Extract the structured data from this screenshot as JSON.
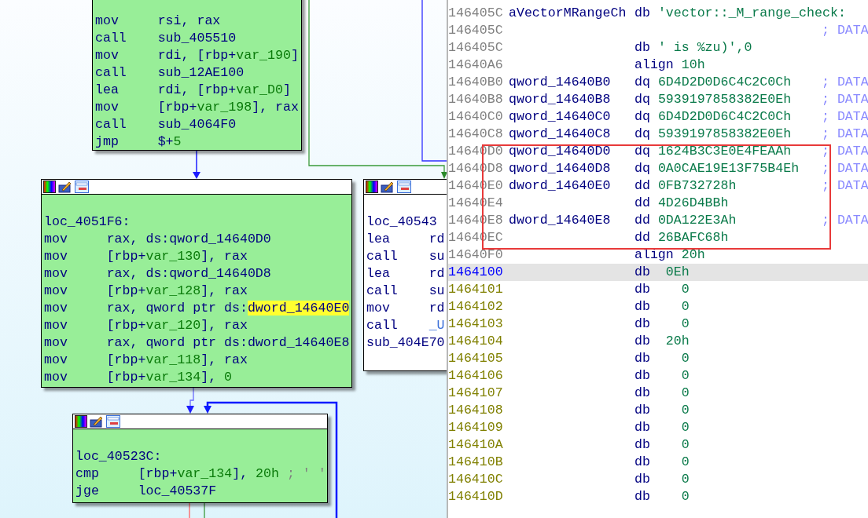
{
  "graph": {
    "nodes": [
      {
        "color": "#98ee98",
        "header": false,
        "lines": [
          {
            "kind": "insn",
            "op": "mov",
            "args": [
              {
                "kind": "plain",
                "text": "rsi, rax"
              }
            ]
          },
          {
            "kind": "insn",
            "op": "call",
            "args": [
              {
                "kind": "plain",
                "text": "sub_405510"
              }
            ]
          },
          {
            "kind": "insn",
            "op": "mov",
            "args": [
              {
                "kind": "plain",
                "text": "rdi, [rbp+"
              },
              {
                "kind": "var",
                "text": "var_190"
              },
              {
                "kind": "plain",
                "text": "]"
              }
            ]
          },
          {
            "kind": "insn",
            "op": "call",
            "args": [
              {
                "kind": "plain",
                "text": "sub_12AE100"
              }
            ]
          },
          {
            "kind": "insn",
            "op": "lea",
            "args": [
              {
                "kind": "plain",
                "text": "rdi, [rbp+"
              },
              {
                "kind": "var",
                "text": "var_D0"
              },
              {
                "kind": "plain",
                "text": "]"
              }
            ]
          },
          {
            "kind": "insn",
            "op": "mov",
            "args": [
              {
                "kind": "plain",
                "text": "[rbp+"
              },
              {
                "kind": "var",
                "text": "var_198"
              },
              {
                "kind": "plain",
                "text": "], rax"
              }
            ]
          },
          {
            "kind": "insn",
            "op": "call",
            "args": [
              {
                "kind": "plain",
                "text": "sub_4064F0"
              }
            ]
          },
          {
            "kind": "insn",
            "op": "jmp",
            "args": [
              {
                "kind": "plain",
                "text": "$+"
              },
              {
                "kind": "num",
                "text": "5"
              }
            ]
          }
        ]
      },
      {
        "color": "#98ee98",
        "header": true,
        "lines": [
          {
            "kind": "label",
            "text": "loc_4051F6:"
          },
          {
            "kind": "insn",
            "op": "mov",
            "args": [
              {
                "kind": "plain",
                "text": "rax, ds:qword_14640D0"
              }
            ]
          },
          {
            "kind": "insn",
            "op": "mov",
            "args": [
              {
                "kind": "plain",
                "text": "[rbp+"
              },
              {
                "kind": "var",
                "text": "var_130"
              },
              {
                "kind": "plain",
                "text": "], rax"
              }
            ]
          },
          {
            "kind": "insn",
            "op": "mov",
            "args": [
              {
                "kind": "plain",
                "text": "rax, ds:qword_14640D8"
              }
            ]
          },
          {
            "kind": "insn",
            "op": "mov",
            "args": [
              {
                "kind": "plain",
                "text": "[rbp+"
              },
              {
                "kind": "var",
                "text": "var_128"
              },
              {
                "kind": "plain",
                "text": "], rax"
              }
            ]
          },
          {
            "kind": "insn",
            "op": "mov",
            "args": [
              {
                "kind": "plain",
                "text": "rax, qword ptr ds:"
              },
              {
                "kind": "hl",
                "text": "dword_14640E0"
              }
            ]
          },
          {
            "kind": "insn",
            "op": "mov",
            "args": [
              {
                "kind": "plain",
                "text": "[rbp+"
              },
              {
                "kind": "var",
                "text": "var_120"
              },
              {
                "kind": "plain",
                "text": "], rax"
              }
            ]
          },
          {
            "kind": "insn",
            "op": "mov",
            "args": [
              {
                "kind": "plain",
                "text": "rax, qword ptr ds:dword_14640E8"
              }
            ]
          },
          {
            "kind": "insn",
            "op": "mov",
            "args": [
              {
                "kind": "plain",
                "text": "[rbp+"
              },
              {
                "kind": "var",
                "text": "var_118"
              },
              {
                "kind": "plain",
                "text": "], rax"
              }
            ]
          },
          {
            "kind": "insn",
            "op": "mov",
            "args": [
              {
                "kind": "plain",
                "text": "[rbp+"
              },
              {
                "kind": "var",
                "text": "var_134"
              },
              {
                "kind": "plain",
                "text": "], "
              },
              {
                "kind": "num",
                "text": "0"
              }
            ]
          }
        ]
      },
      {
        "color": "#ffffff",
        "header": true,
        "lines": [
          {
            "kind": "label",
            "text": "loc_40543"
          },
          {
            "kind": "insn",
            "op": "lea",
            "args": [
              {
                "kind": "plain",
                "text": "rd"
              }
            ]
          },
          {
            "kind": "insn",
            "op": "call",
            "args": [
              {
                "kind": "plain",
                "text": "su"
              }
            ]
          },
          {
            "kind": "insn",
            "op": "lea",
            "args": [
              {
                "kind": "plain",
                "text": "rd"
              }
            ]
          },
          {
            "kind": "insn",
            "op": "call",
            "args": [
              {
                "kind": "plain",
                "text": "su"
              }
            ]
          },
          {
            "kind": "insn",
            "op": "mov",
            "args": [
              {
                "kind": "plain",
                "text": "rd"
              }
            ]
          },
          {
            "kind": "insn",
            "op": "call",
            "args": [
              {
                "kind": "import",
                "text": "_U"
              }
            ]
          },
          {
            "kind": "label",
            "text": "sub_404E70"
          }
        ]
      },
      {
        "color": "#98ee98",
        "header": true,
        "lines": [
          {
            "kind": "label",
            "text": "loc_40523C:"
          },
          {
            "kind": "insn",
            "op": "cmp",
            "args": [
              {
                "kind": "plain",
                "text": "[rbp+"
              },
              {
                "kind": "var",
                "text": "var_134"
              },
              {
                "kind": "plain",
                "text": "], "
              },
              {
                "kind": "num",
                "text": "20h"
              },
              {
                "kind": "cmt",
                "text": " ; ' '"
              }
            ]
          },
          {
            "kind": "insn",
            "op": "jge",
            "args": [
              {
                "kind": "plain",
                "text": "loc_40537F"
              }
            ]
          }
        ]
      }
    ]
  },
  "listing": {
    "rows": [
      {
        "kind": "data",
        "selected": false,
        "address": "146405C",
        "label": "aVectorMRangeCh",
        "mnemonic": "db",
        "operand": "'vector::_M_range_check:"
      },
      {
        "kind": "data",
        "selected": false,
        "address": "146405C",
        "comment": "; DATA"
      },
      {
        "kind": "data",
        "selected": false,
        "address": "146405C",
        "mnemonic": "db",
        "operand": "' is %zu)',0"
      },
      {
        "kind": "data",
        "selected": false,
        "address": "14640A6",
        "mnemonic": "align",
        "operand": "10h"
      },
      {
        "kind": "data",
        "selected": false,
        "address": "14640B0",
        "label": "qword_14640B0",
        "mnemonic": "dq",
        "operand": "6D4D2D0D6C4C2C0Ch",
        "comment": "; DATA"
      },
      {
        "kind": "data",
        "selected": false,
        "address": "14640B8",
        "label": "qword_14640B8",
        "mnemonic": "dq",
        "operand": "5939197858382E0Eh",
        "comment": "; DATA"
      },
      {
        "kind": "data",
        "selected": false,
        "address": "14640C0",
        "label": "qword_14640C0",
        "mnemonic": "dq",
        "operand": "6D4D2D0D6C4C2C0Ch",
        "comment": "; DATA"
      },
      {
        "kind": "data",
        "selected": false,
        "address": "14640C8",
        "label": "qword_14640C8",
        "mnemonic": "dq",
        "operand": "5939197858382E0Eh",
        "comment": "; DATA"
      },
      {
        "kind": "data",
        "selected": false,
        "address": "14640D0",
        "label": "qword_14640D0",
        "mnemonic": "dq",
        "operand": "1624B3C3E0E4FEAAh",
        "comment": "; DATA"
      },
      {
        "kind": "data",
        "selected": false,
        "address": "14640D8",
        "label": "qword_14640D8",
        "mnemonic": "dq",
        "operand": "0A0CAE19E13F75B4Eh",
        "comment": "; DATA"
      },
      {
        "kind": "data",
        "selected": false,
        "address": "14640E0",
        "label": "dword_14640E0",
        "mnemonic": "dd",
        "operand": "0FB732728h",
        "comment": "; DATA"
      },
      {
        "kind": "data",
        "selected": false,
        "address": "14640E4",
        "mnemonic": "dd",
        "operand": "4D26D4BBh"
      },
      {
        "kind": "data",
        "selected": false,
        "address": "14640E8",
        "label": "dword_14640E8",
        "mnemonic": "dd",
        "operand": "0DA122E3Ah",
        "comment": "; DATA"
      },
      {
        "kind": "data",
        "selected": false,
        "address": "14640EC",
        "mnemonic": "dd",
        "operand": "26BAFC68h"
      },
      {
        "kind": "data",
        "selected": false,
        "address": "14640F0",
        "mnemonic": "align",
        "operand": "20h"
      },
      {
        "kind": "byte",
        "selected": true,
        "address": "1464100",
        "mnemonic": "db",
        "operand": "0Eh"
      },
      {
        "kind": "byte",
        "selected": false,
        "address": "1464101",
        "mnemonic": "db",
        "operand": "0"
      },
      {
        "kind": "byte",
        "selected": false,
        "address": "1464102",
        "mnemonic": "db",
        "operand": "0"
      },
      {
        "kind": "byte",
        "selected": false,
        "address": "1464103",
        "mnemonic": "db",
        "operand": "0"
      },
      {
        "kind": "byte",
        "selected": false,
        "address": "1464104",
        "mnemonic": "db",
        "operand": "20h"
      },
      {
        "kind": "byte",
        "selected": false,
        "address": "1464105",
        "mnemonic": "db",
        "operand": "0"
      },
      {
        "kind": "byte",
        "selected": false,
        "address": "1464106",
        "mnemonic": "db",
        "operand": "0"
      },
      {
        "kind": "byte",
        "selected": false,
        "address": "1464107",
        "mnemonic": "db",
        "operand": "0"
      },
      {
        "kind": "byte",
        "selected": false,
        "address": "1464108",
        "mnemonic": "db",
        "operand": "0"
      },
      {
        "kind": "byte",
        "selected": false,
        "address": "1464109",
        "mnemonic": "db",
        "operand": "0"
      },
      {
        "kind": "byte",
        "selected": false,
        "address": "146410A",
        "mnemonic": "db",
        "operand": "0"
      },
      {
        "kind": "byte",
        "selected": false,
        "address": "146410B",
        "mnemonic": "db",
        "operand": "0"
      },
      {
        "kind": "byte",
        "selected": false,
        "address": "146410C",
        "mnemonic": "db",
        "operand": "0"
      },
      {
        "kind": "byte",
        "selected": false,
        "address": "146410D",
        "mnemonic": "db",
        "operand": "0"
      }
    ]
  }
}
